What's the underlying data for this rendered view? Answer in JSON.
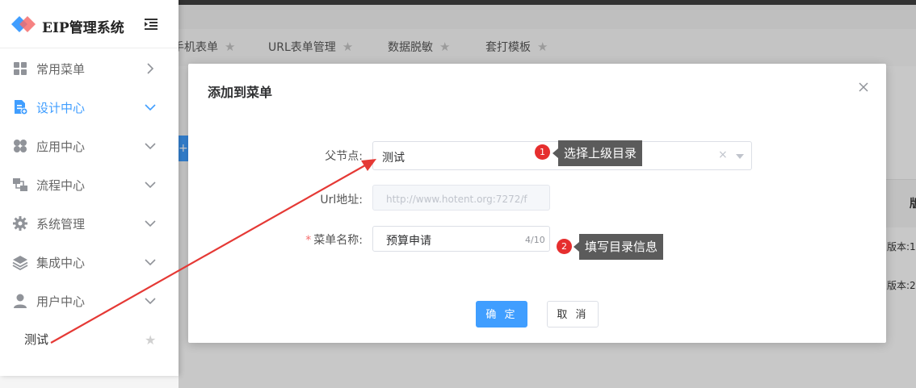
{
  "app": {
    "title": "EIP管理系统"
  },
  "bg_tabs": [
    {
      "label": "手机表单"
    },
    {
      "label": "URL表单管理"
    },
    {
      "label": "数据脱敏"
    },
    {
      "label": "套打模板"
    }
  ],
  "bg_table": {
    "header_fragment": "版",
    "rows": [
      "版本:1",
      "版本:2"
    ],
    "add_button": "+"
  },
  "sidebar": {
    "items": [
      {
        "label": "常用菜单",
        "icon": "grid-icon",
        "arrow": "right"
      },
      {
        "label": "设计中心",
        "icon": "design-doc-icon",
        "arrow": "down",
        "active": true
      },
      {
        "label": "应用中心",
        "icon": "clover-icon",
        "arrow": "down"
      },
      {
        "label": "流程中心",
        "icon": "flow-icon",
        "arrow": "down"
      },
      {
        "label": "系统管理",
        "icon": "gear-icon",
        "arrow": "down"
      },
      {
        "label": "集成中心",
        "icon": "layers-icon",
        "arrow": "down"
      },
      {
        "label": "用户中心",
        "icon": "user-icon",
        "arrow": "down"
      }
    ],
    "submenu_item": "测试"
  },
  "dialog": {
    "title": "添加到菜单",
    "parent_label": "父节点:",
    "parent_value": "测试",
    "url_label": "Url地址:",
    "url_placeholder": "http://www.hotent.org:7272/f",
    "name_label": "菜单名称:",
    "name_value": "预算申请",
    "name_count": "4/10",
    "confirm": "确 定",
    "cancel": "取 消"
  },
  "annotations": [
    {
      "number": "1",
      "text": "选择上级目录"
    },
    {
      "number": "2",
      "text": "填写目录信息"
    }
  ],
  "colors": {
    "primary": "#409eff",
    "annotation_red": "#e62e2e",
    "callout_bg": "#5b5b5b",
    "required": "#f56c6c"
  }
}
